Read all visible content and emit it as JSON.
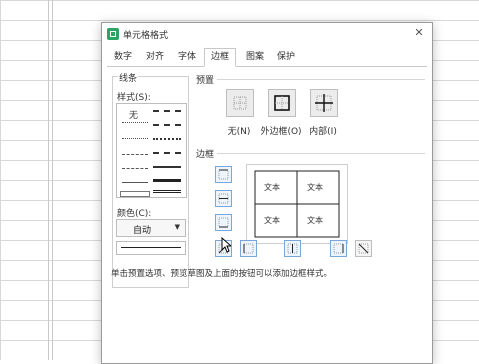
{
  "dialog": {
    "title": "单元格格式",
    "close_icon": "close-icon",
    "tabs": [
      "数字",
      "对齐",
      "字体",
      "边框",
      "图案",
      "保护"
    ],
    "active_tab": "边框"
  },
  "line": {
    "group_label": "线条",
    "style_label": "样式(S):",
    "style_none": "无",
    "color_label": "颜色(C):",
    "color_value": "自动"
  },
  "presets": {
    "label": "预置",
    "items": [
      {
        "label": "无(N)",
        "icon": "preset-none-icon"
      },
      {
        "label": "外边框(O)",
        "icon": "preset-outline-icon"
      },
      {
        "label": "内部(I)",
        "icon": "preset-inside-icon"
      }
    ]
  },
  "border": {
    "label": "边框",
    "cells": [
      "文本",
      "文本",
      "文本",
      "文本"
    ]
  },
  "hint": "单击预置选项、预览草图及上面的按钮可以添加边框样式。",
  "colors": {
    "dialog_bg": "#ffffff",
    "grid": "#d8d8d8",
    "accent_green": "#2aa564",
    "button_blue": "#7aa6d8"
  }
}
